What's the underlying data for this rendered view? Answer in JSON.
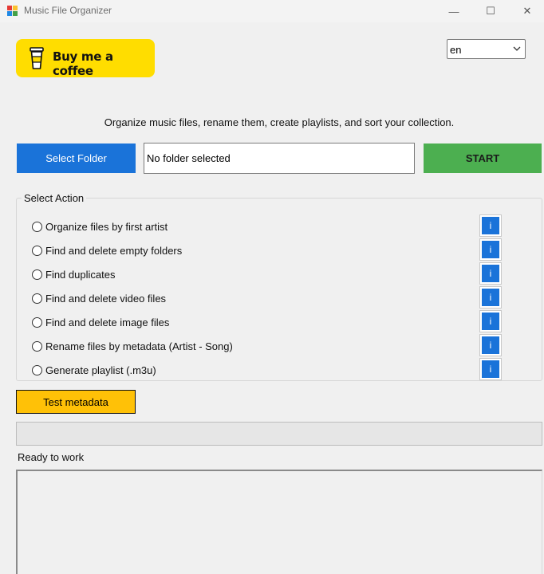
{
  "window": {
    "title": "Music File Organizer",
    "controls": {
      "minimize": "—",
      "maximize": "☐",
      "close": "✕"
    }
  },
  "header": {
    "coffee_button_label": "Buy me a coffee",
    "language": {
      "selected": "en",
      "options": [
        "en"
      ]
    }
  },
  "subtitle": "Organize music files, rename them, create playlists, and sort your collection.",
  "folder": {
    "select_button_label": "Select Folder",
    "path_value": "No folder selected",
    "start_button_label": "START"
  },
  "actions": {
    "group_title": "Select Action",
    "info_label": "i",
    "options": [
      {
        "label": "Organize files by first artist",
        "selected": false
      },
      {
        "label": "Find and delete empty folders",
        "selected": false
      },
      {
        "label": "Find duplicates",
        "selected": false
      },
      {
        "label": "Find and delete video files",
        "selected": false
      },
      {
        "label": "Find and delete image files",
        "selected": false
      },
      {
        "label": "Rename files by metadata (Artist - Song)",
        "selected": false
      },
      {
        "label": "Generate playlist (.m3u)",
        "selected": false
      }
    ]
  },
  "test_metadata_label": "Test metadata",
  "progress": {
    "fraction": 0
  },
  "status_text": "Ready to work",
  "log_text": "",
  "colors": {
    "coffee_yellow": "#ffdd00",
    "primary_blue": "#1a73d9",
    "start_green": "#4caf50",
    "test_amber": "#ffc107",
    "window_bg": "#f0f0f0"
  },
  "icons": {
    "app": "app-icon",
    "coffee": "coffee-cup-icon",
    "dropdown": "chevron-down-icon",
    "info": "info-icon"
  }
}
